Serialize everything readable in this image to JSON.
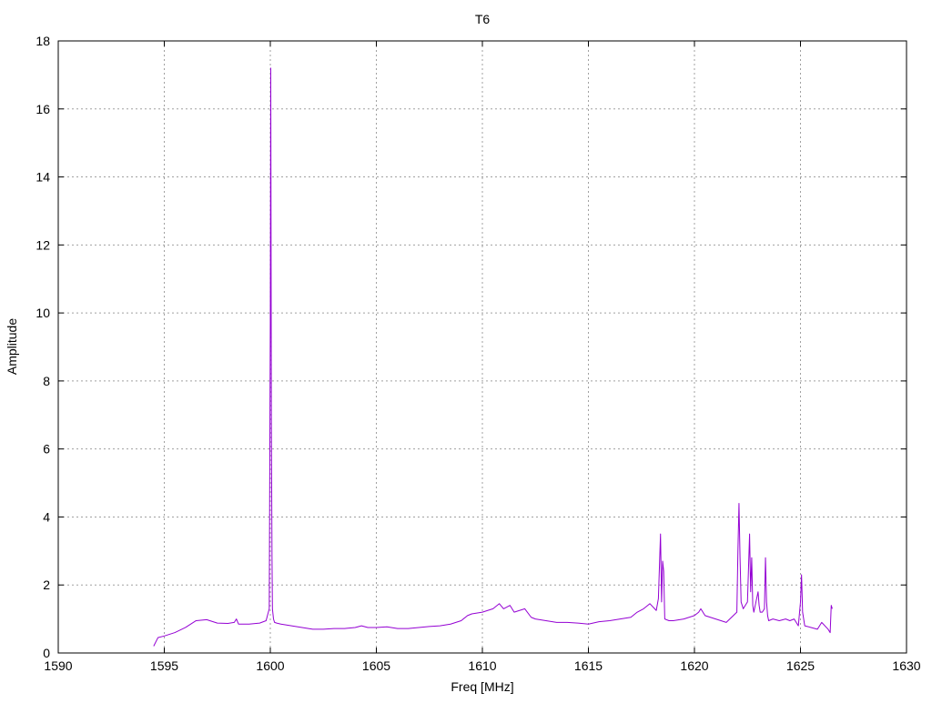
{
  "chart_data": {
    "type": "line",
    "title": "T6",
    "xlabel": "Freq [MHz]",
    "ylabel": "Amplitude",
    "xlim": [
      1590,
      1630
    ],
    "ylim": [
      0,
      18
    ],
    "xticks": [
      1590,
      1595,
      1600,
      1605,
      1610,
      1615,
      1620,
      1625,
      1630
    ],
    "yticks": [
      0,
      2,
      4,
      6,
      8,
      10,
      12,
      14,
      16,
      18
    ],
    "grid": true,
    "legend": "none",
    "colors": {
      "series": "#9400d3",
      "grid": "#a0a0a0",
      "axis": "#000000"
    },
    "series": [
      {
        "x": [
          1594.5,
          1594.7,
          1595.0,
          1595.5,
          1596.0,
          1596.5,
          1597.0,
          1597.5,
          1598.0,
          1598.3,
          1598.4,
          1598.5,
          1599.0,
          1599.5,
          1599.8,
          1599.95,
          1600.0,
          1600.02,
          1600.05,
          1600.08,
          1600.1,
          1600.15,
          1600.2,
          1600.3,
          1600.5,
          1601.0,
          1601.5,
          1602.0,
          1602.5,
          1603.0,
          1603.5,
          1604.0,
          1604.3,
          1604.6,
          1605.0,
          1605.5,
          1606.0,
          1606.5,
          1607.0,
          1607.5,
          1608.0,
          1608.5,
          1609.0,
          1609.3,
          1609.5,
          1610.0,
          1610.5,
          1610.8,
          1611.0,
          1611.3,
          1611.5,
          1612.0,
          1612.3,
          1612.5,
          1613.0,
          1613.5,
          1614.0,
          1614.5,
          1615.0,
          1615.5,
          1616.0,
          1616.5,
          1617.0,
          1617.3,
          1617.6,
          1617.9,
          1618.2,
          1618.3,
          1618.4,
          1618.45,
          1618.5,
          1618.55,
          1618.6,
          1618.8,
          1619.0,
          1619.5,
          1620.0,
          1620.2,
          1620.3,
          1620.5,
          1621.0,
          1621.5,
          1622.0,
          1622.05,
          1622.1,
          1622.15,
          1622.2,
          1622.3,
          1622.5,
          1622.6,
          1622.65,
          1622.7,
          1622.75,
          1622.8,
          1622.9,
          1623.0,
          1623.05,
          1623.1,
          1623.2,
          1623.3,
          1623.35,
          1623.4,
          1623.45,
          1623.5,
          1623.7,
          1624.0,
          1624.3,
          1624.5,
          1624.7,
          1624.9,
          1625.0,
          1625.05,
          1625.1,
          1625.2,
          1625.5,
          1625.8,
          1626.0,
          1626.3,
          1626.4,
          1626.45,
          1626.5
        ],
        "y": [
          0.2,
          0.45,
          0.5,
          0.6,
          0.75,
          0.95,
          0.98,
          0.88,
          0.87,
          0.9,
          1.0,
          0.85,
          0.85,
          0.88,
          0.95,
          1.3,
          9.7,
          17.2,
          6.8,
          2.8,
          1.3,
          1.0,
          0.9,
          0.88,
          0.85,
          0.8,
          0.75,
          0.7,
          0.7,
          0.72,
          0.72,
          0.75,
          0.8,
          0.75,
          0.75,
          0.77,
          0.72,
          0.72,
          0.75,
          0.78,
          0.8,
          0.85,
          0.95,
          1.1,
          1.15,
          1.2,
          1.3,
          1.45,
          1.3,
          1.4,
          1.2,
          1.3,
          1.05,
          1.0,
          0.95,
          0.9,
          0.9,
          0.88,
          0.85,
          0.92,
          0.95,
          1.0,
          1.05,
          1.2,
          1.3,
          1.45,
          1.25,
          1.6,
          3.5,
          1.5,
          2.7,
          2.4,
          1.0,
          0.95,
          0.95,
          1.0,
          1.1,
          1.2,
          1.3,
          1.1,
          1.0,
          0.9,
          1.2,
          3.0,
          4.4,
          2.8,
          1.5,
          1.3,
          1.5,
          3.5,
          1.8,
          2.8,
          1.4,
          1.2,
          1.5,
          1.8,
          1.4,
          1.2,
          1.2,
          1.3,
          2.8,
          1.5,
          1.1,
          0.95,
          1.0,
          0.95,
          1.0,
          0.95,
          1.0,
          0.8,
          1.5,
          2.3,
          1.2,
          0.8,
          0.75,
          0.7,
          0.9,
          0.7,
          0.6,
          1.4,
          1.3
        ]
      }
    ]
  }
}
